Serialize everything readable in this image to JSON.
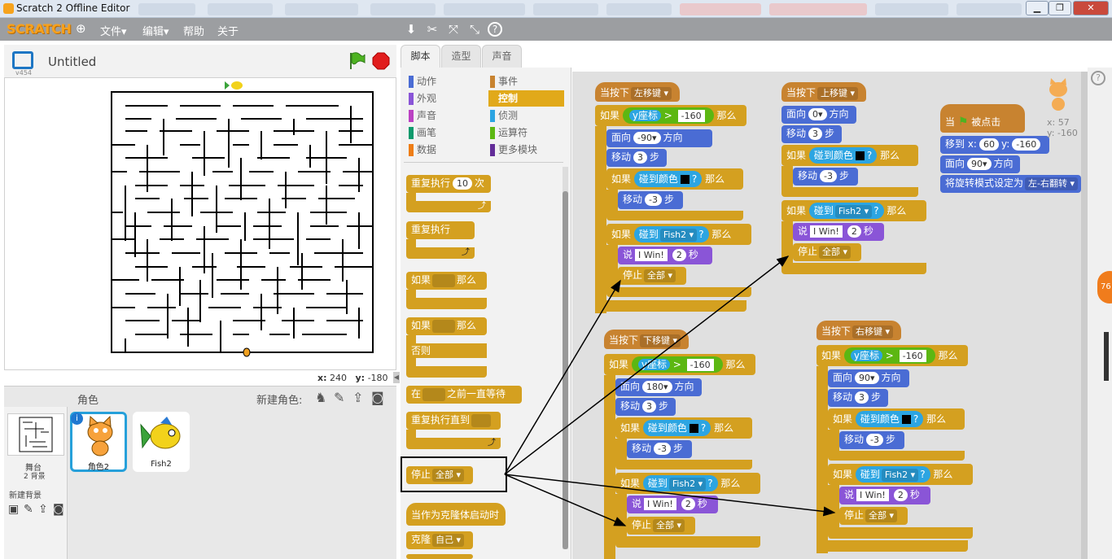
{
  "window": {
    "title": "Scratch 2 Offline Editor",
    "minimize": "▁",
    "restore": "❐",
    "close": "✕"
  },
  "menubar": {
    "logo": "SCRATCH",
    "globe": "⊕",
    "file": "文件▾",
    "edit": "编辑▾",
    "tips": "帮助",
    "about": "关于"
  },
  "toolbar": {
    "duplicate": "⬇",
    "delete": "✂",
    "grow": "⤧",
    "shrink": "⤡",
    "help": "?"
  },
  "stage": {
    "project_title": "Untitled",
    "version": "v454",
    "x_label": "x:",
    "x_value": "240",
    "y_label": "y:",
    "y_value": "-180"
  },
  "tabs": [
    "脚本",
    "造型",
    "声音"
  ],
  "sprites_pane": {
    "title": "角色",
    "new_sprite_label": "新建角色:",
    "stage_label": "舞台",
    "backdrops": "2 背景",
    "new_backdrop": "新建背景",
    "sprites": [
      {
        "name": "角色2"
      },
      {
        "name": "Fish2"
      }
    ]
  },
  "categories": [
    {
      "label": "动作",
      "color": "#4a6cd4"
    },
    {
      "label": "事件",
      "color": "#c88330"
    },
    {
      "label": "外观",
      "color": "#8a55d7"
    },
    {
      "label": "控制",
      "color": "#e1a91a"
    },
    {
      "label": "声音",
      "color": "#bb42c3"
    },
    {
      "label": "侦测",
      "color": "#2ca5e2"
    },
    {
      "label": "画笔",
      "color": "#0e9a6c"
    },
    {
      "label": "运算符",
      "color": "#5cb712"
    },
    {
      "label": "数据",
      "color": "#ee7d16"
    },
    {
      "label": "更多模块",
      "color": "#632d99"
    }
  ],
  "palette_blocks": {
    "repeat": "重复执行",
    "repeat_n": "10",
    "repeat_suffix": "次",
    "forever": "重复执行",
    "if": "如果",
    "then": "那么",
    "if2": "如果",
    "then2": "那么",
    "else": "否则",
    "wait_until_pre": "在",
    "wait_until_post": "之前一直等待",
    "repeat_until": "重复执行直到",
    "stop": "停止",
    "stop_opt": "全部",
    "clone_start": "当作为克隆体启动时",
    "clone": "克隆",
    "clone_opt": "自己"
  },
  "scripts": {
    "left": {
      "hat": "当按下",
      "key": "左移键",
      "if": "如果",
      "ycoord": "y座标",
      "gt": ">",
      "val": "-160",
      "then": "那么",
      "face": "面向",
      "dir": "-90",
      "dir_suffix": "方向",
      "move": "移动",
      "steps": "3",
      "steps_suffix": "步",
      "touch_color": "碰到颜色",
      "q": "?",
      "move_back": "-3",
      "touch": "碰到",
      "target": "Fish2",
      "say": "说",
      "msg": "I Win!",
      "secs": "2",
      "secs_suffix": "秒",
      "stop": "停止",
      "stop_opt": "全部"
    },
    "up": {
      "hat": "当按下",
      "key": "上移键",
      "face": "面向",
      "dir": "0",
      "dir_suffix": "方向",
      "move": "移动",
      "steps": "3",
      "steps_suffix": "步",
      "if": "如果",
      "touch_color": "碰到颜色",
      "q": "?",
      "then": "那么",
      "move_back": "-3",
      "touch": "碰到",
      "target": "Fish2",
      "say": "说",
      "msg": "I Win!",
      "secs": "2",
      "secs_suffix": "秒",
      "stop": "停止",
      "stop_opt": "全部"
    },
    "flag": {
      "hat_pre": "当",
      "hat_post": "被点击",
      "goto": "移到 x:",
      "x": "60",
      "y_label": "y:",
      "y": "-160",
      "face": "面向",
      "dir": "90",
      "dir_suffix": "方向",
      "rot": "将旋转模式设定为",
      "rot_opt": "左-右翻转"
    },
    "down": {
      "hat": "当按下",
      "key": "下移键",
      "if": "如果",
      "ycoord": "y座标",
      "gt": ">",
      "val": "-160",
      "then": "那么",
      "face": "面向",
      "dir": "180",
      "dir_suffix": "方向",
      "move": "移动",
      "steps": "3",
      "steps_suffix": "步",
      "touch_color": "碰到颜色",
      "q": "?",
      "move_back": "-3",
      "touch": "碰到",
      "target": "Fish2",
      "say": "说",
      "msg": "I Win!",
      "secs": "2",
      "secs_suffix": "秒",
      "stop": "停止",
      "stop_opt": "全部"
    },
    "right": {
      "hat": "当按下",
      "key": "右移键",
      "if": "如果",
      "ycoord": "y座标",
      "gt": ">",
      "val": "-160",
      "then": "那么",
      "face": "面向",
      "dir": "90",
      "dir_suffix": "方向",
      "move": "移动",
      "steps": "3",
      "steps_suffix": "步",
      "touch_color": "碰到颜色",
      "q": "?",
      "move_back": "-3",
      "touch": "碰到",
      "target": "Fish2",
      "say": "说",
      "msg": "I Win!",
      "secs": "2",
      "secs_suffix": "秒",
      "stop": "停止",
      "stop_opt": "全部"
    }
  },
  "sprite_info": {
    "x_label": "x:",
    "x": "57",
    "y_label": "y:",
    "y": "-160"
  },
  "badge": "76"
}
